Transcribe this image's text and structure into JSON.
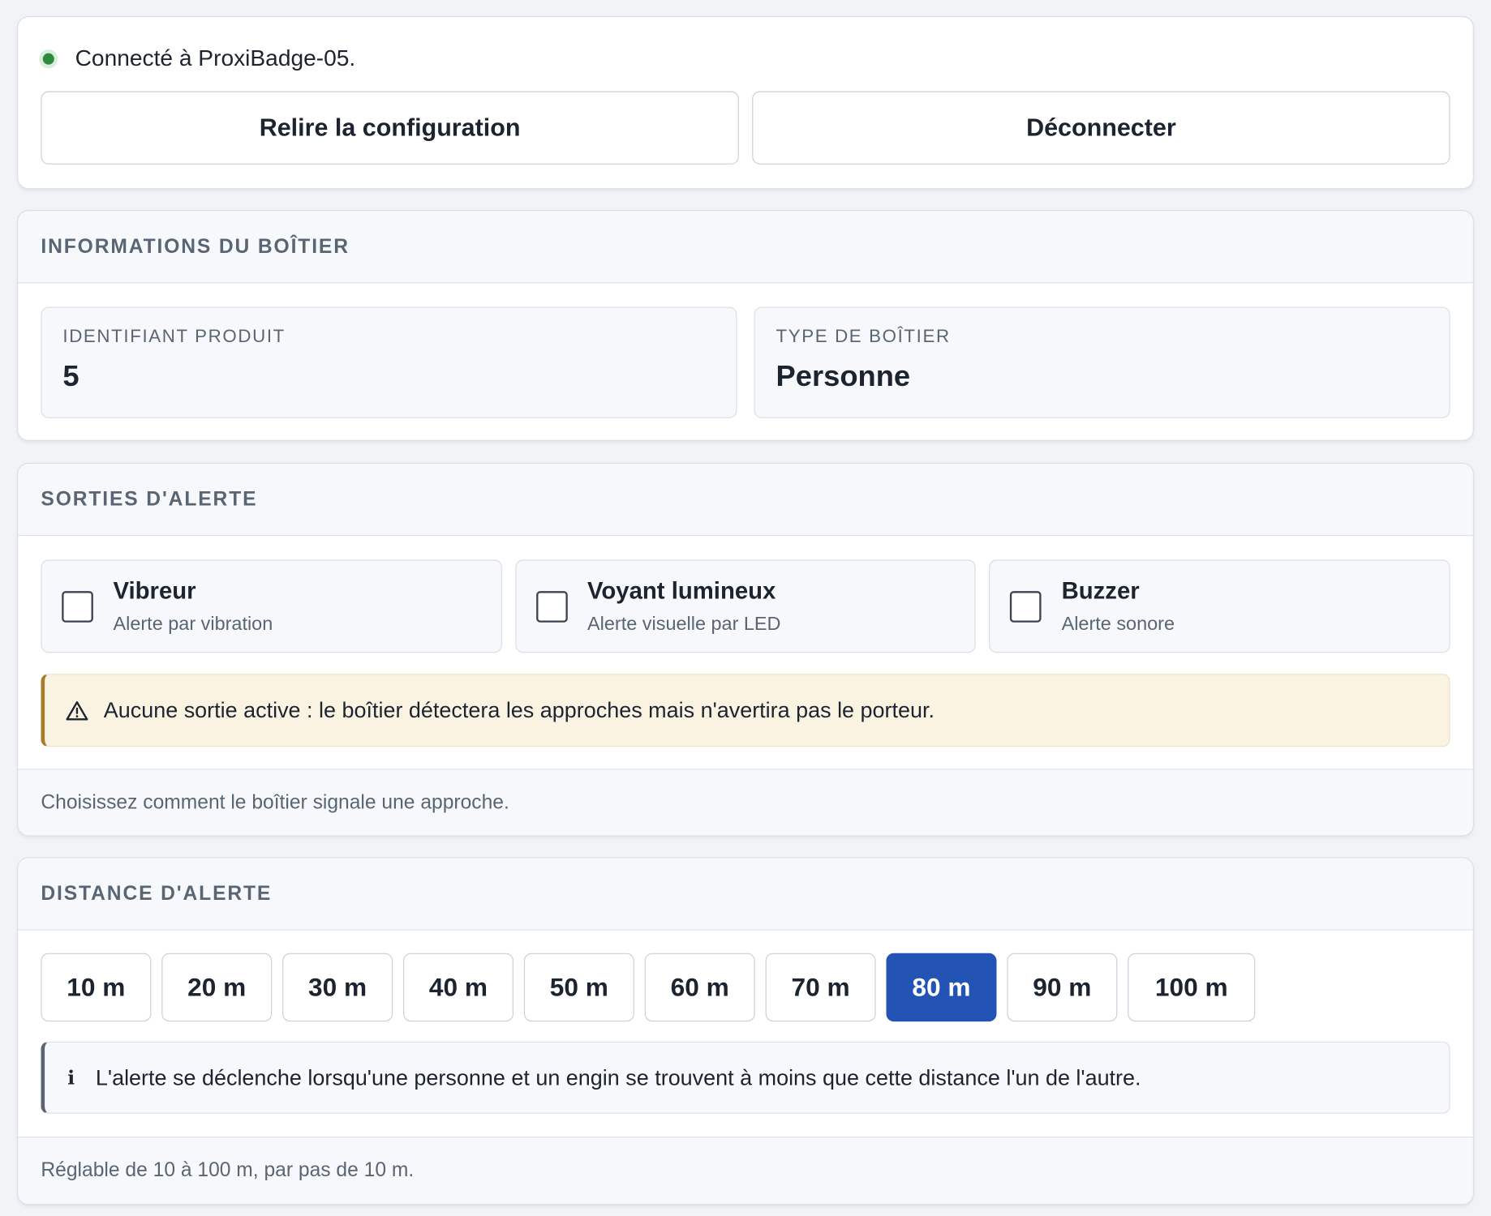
{
  "connection": {
    "status_text": "Connecté à ProxiBadge-05.",
    "reload_label": "Relire la configuration",
    "disconnect_label": "Déconnecter"
  },
  "info": {
    "title": "INFORMATIONS DU BOÎTIER",
    "product_id_label": "IDENTIFIANT PRODUIT",
    "product_id_value": "5",
    "type_label": "TYPE DE BOÎTIER",
    "type_value": "Personne"
  },
  "outputs": {
    "title": "SORTIES D'ALERTE",
    "options": [
      {
        "title": "Vibreur",
        "subtitle": "Alerte par vibration",
        "checked": false
      },
      {
        "title": "Voyant lumineux",
        "subtitle": "Alerte visuelle par LED",
        "checked": false
      },
      {
        "title": "Buzzer",
        "subtitle": "Alerte sonore",
        "checked": false
      }
    ],
    "warning": "Aucune sortie active : le boîtier détectera les approches mais n'avertira pas le porteur.",
    "footer": "Choisissez comment le boîtier signale une approche."
  },
  "distance": {
    "title": "DISTANCE D'ALERTE",
    "options": [
      "10 m",
      "20 m",
      "30 m",
      "40 m",
      "50 m",
      "60 m",
      "70 m",
      "80 m",
      "90 m",
      "100 m"
    ],
    "selected": "80 m",
    "note": "L'alerte se déclenche lorsqu'une personne et un engin se trouvent à moins que cette distance l'un de l'autre.",
    "footer": "Réglable de 10 à 100 m, par pas de 10 m."
  },
  "colors": {
    "accent": "#2353b5",
    "status_ok": "#2f8a3e",
    "warning_border": "#a87a2c",
    "warning_bg": "#fbf3e2"
  },
  "icons": {
    "status": "status-dot-icon",
    "warning": "warning-triangle-icon",
    "info": "info-icon"
  }
}
